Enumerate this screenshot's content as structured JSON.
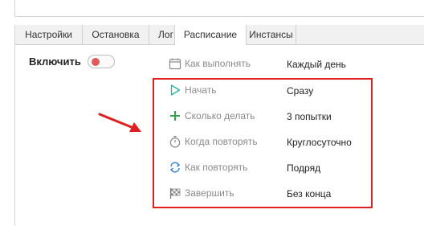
{
  "tabs": [
    {
      "label": "Настройки"
    },
    {
      "label": "Остановка"
    },
    {
      "label": "Лог"
    },
    {
      "label": "Расписание",
      "active": true
    },
    {
      "label": "Инстансы"
    }
  ],
  "enable": {
    "label": "Включить",
    "on": false
  },
  "schedule": [
    {
      "label": "Как выполнять",
      "value": "Каждый день",
      "icon": "calendar-icon"
    },
    {
      "label": "Начать",
      "value": "Сразу",
      "icon": "play-icon"
    },
    {
      "label": "Сколько делать",
      "value": "3 попытки",
      "icon": "plus-icon"
    },
    {
      "label": "Когда повторять",
      "value": "Круглосуточно",
      "icon": "stopwatch-icon"
    },
    {
      "label": "Как повторять",
      "value": "Подряд",
      "icon": "repeat-icon"
    },
    {
      "label": "Завершить",
      "value": "Без конца",
      "icon": "checkered-flag-icon"
    }
  ],
  "colors": {
    "highlight": "#e02020",
    "toggle_knob": "#e05a5a",
    "play": "#2bb3a0",
    "plus": "#2aa34a",
    "repeat": "#2f7fd6"
  }
}
